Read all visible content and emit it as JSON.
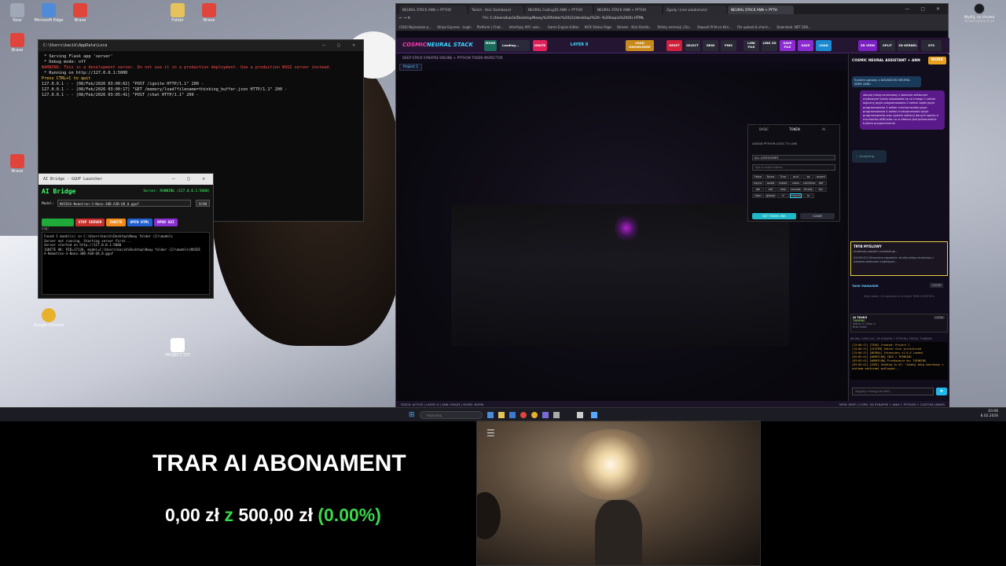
{
  "desktop": {
    "icons": [
      {
        "label": "Kosz",
        "color": "#a0a8b8"
      },
      {
        "label": "Microsoft Edge",
        "color": "#4f8bd8"
      },
      {
        "label": "Brave",
        "color": "#e0443a"
      },
      {
        "label": "Folder",
        "color": "#e6c25a"
      },
      {
        "label": "Brave",
        "color": "#e0443a"
      },
      {
        "label": "Brave",
        "color": "#e0443a"
      },
      {
        "label": "Brave",
        "color": "#e0443a"
      },
      {
        "label": "Google Chrome",
        "color": "#e8b12c"
      },
      {
        "label": "PROJECT.TXT",
        "color": "#ffffff"
      }
    ]
  },
  "cmd_window": {
    "title": "C:\\Users\\kacik\\AppData\\Loca",
    "lines": [
      " * Serving Flask app 'server'",
      " * Debug mode: off",
      "WARNING: This is a development server. Do not use it in a production deployment. Use a production WSGI server instead.",
      " * Running on http://127.0.0.1:5000",
      "Press CTRL+C to quit",
      "127.0.0.1 - - [08/Feb/2026 03:00:02] \"POST /ignite HTTP/1.1\" 200 -",
      "127.0.0.1 - - [08/Feb/2026 03:00:17] \"GET /memory/load?filename=thinking_buffer.json HTTP/1.1\" 200 -",
      "127.0.0.1 - - [08/Feb/2026 03:05:41] \"POST /chat HTTP/1.1\" 200 -"
    ]
  },
  "ai_bridge": {
    "window_title": "AI Bridge - GGUF Launcher",
    "title": "AI Bridge",
    "server_status": "Server: RUNNING (127.0.0.1:5000)",
    "model_label": "Model:",
    "model_value": "NVIDIA-Nemotron-3-Nano-30B-A3B-Q8_0.gguf",
    "scan_label": "SCAN",
    "buttons": {
      "start": "START SERVER",
      "stop": "STOP SERVER",
      "ignite": "IGNITE",
      "open_html": "OPEN HTML",
      "open_gui": "OPEN GUI"
    },
    "log_label": "Log:",
    "log_lines": [
      "Found 1 model(s) in C:\\Users\\kacik\\Desktop\\Nowy folder (2)\\models",
      "Server not running. Starting server first...",
      "Server started on http://127.0.0.1:5000",
      "IGNITE OK: PID=17136, model=C:\\Users\\kacik\\Desktop\\Nowy folder (2)\\models\\NVIDI",
      "A-Nemotron-3-Nano-30B-A3B-Q8_0.gguf"
    ]
  },
  "browser": {
    "tabs": [
      "NEURAL STACK ANN + PYTHO",
      "Twitch - Kick Dashboard",
      "NEURAL Coding3D ANN + PYTHO",
      "NEURAL STACK ANN + PYTHO",
      "Zgody i inne wiadomości",
      "NEURAL STACK ANN + PYTH"
    ],
    "address": "C:/Users/kacik/Desktop/Nowy%20folder%20(2)/desktop/%20--%20kopia%20(6).HTML",
    "address_prefix": "Plik",
    "bookmarks": [
      "(184) Najnowsze p...",
      "Stripe Express - Login",
      "Platform | Chat...",
      "Interfejsy API i usłu...",
      "Game Engine Editor",
      "KICK Status Page",
      "Stream - Kick Dashb...",
      "Efekty animacji | Do...",
      "Deposit Pl-N on Kim...",
      "File upload & sharin...",
      "Download .NET SDK..."
    ]
  },
  "app": {
    "logo_a": "COSMIC",
    "logo_b": "NEURAL STACK",
    "toolbar": {
      "mode": "MODE",
      "loading": "Loading...",
      "ignite": "IGNITE",
      "layer": "LAYER 8",
      "load_knowledge": "LOAD KNOWLEDGE",
      "reset": "RESET",
      "select": "SELECT",
      "grid": "GRID",
      "pins": "PINS",
      "link_file": "LINK FILE",
      "link_2d": "LINK 2D",
      "save_file": "SAVE FILE",
      "save": "SAVE",
      "load": "LOAD",
      "view_3d": "3D VIEW",
      "split": "SPLIT",
      "kernel": "2D KERNEL",
      "sys": "SYS"
    },
    "subtitle": "DEEP STACK SYNAPSE ENGINE + PYTHON TOKEN INSPECTOR",
    "project_tab": "Project 1",
    "token_panel": {
      "tabs": [
        "BASIC",
        "TOKEN",
        "AI"
      ],
      "heading": "ASSIGN PYTHON LOGIC TO LINK",
      "category": "ALL CATEGORIES",
      "search_placeholder": "Type to search tokens...",
      "tokens": [
        "False",
        "None",
        "True",
        "and",
        "as",
        "assert",
        "async",
        "await",
        "break",
        "class",
        "continue",
        "def",
        "del",
        "elif",
        "else",
        "except",
        "finally",
        "for",
        "from",
        "global",
        "if",
        "import",
        "in"
      ],
      "set_button": "SET TOKEN LINK",
      "clear_button": "CLEAR"
    },
    "assistant": {
      "title": "COSMIC NEURAL ASSISTANT + ANN",
      "badge": "WORK",
      "system_msg": "System gotowy z ADVANCED NEURAL WIRE ANN!",
      "user_msg": "zbuduj mózg neuronowy z wieloma sektorami myślowymi każdy odpowiada za co innego 1 sektor logiczny język programowania 2 sektor logiki język programowania 3 sektor mechanizmów język programowania 4 sektor funkcjonalności język programowania oraz system selekcji danych sporty a mechanika ANN wiec co w efekcie jest jednocześnie trybem przypomnienia",
      "thinking_label": "Analyzing",
      "thinking_mode_title": "TRYB MYŚLOWY",
      "thinking_mode_text": "Analizuję projekt i przewiduję...",
      "thinking_log": "[03:05:41] Otrzymano zapytanie: zbuduj mózg neuronowy z wieloma sektorami myślowymi...",
      "task_manager": "TASK MANAGER",
      "task_clear": "CLEAR",
      "task_empty": "Brak zadań. AI zaplanuje je w trybie TASK LOGISTICS",
      "ai_tasks": "AI TASKS",
      "ai_tasks_clear": "CLEAR",
      "ai_status_lines": [
        "THINKING",
        "Status: 0 | Step: 0",
        "Brak zadań"
      ],
      "log_header": "NEURAL CORE LOG | 3D SYNAPSE + PYTHON | STATUS: THINKING",
      "log_lines": [
        "[13:00:17] [TASK] Created: Project 1",
        "[13:00:17] [SYSTEM] Editor Core initialized",
        "[13:00:17] [NEURAL] Extensions v1.0.0 loaded",
        "[03:05:41] [WORKFLOW] IDLE > THINKING",
        "[03:05:41] [WORKFLOW] Przekazanie do: THINKING",
        "[03:05:41] [CHAT] Sending to AI: \"zbuduj mózg neuronowy z wieloma sektorami myślowymi..."
      ],
      "input_placeholder": "Zapytaj o kreację lub ANN..."
    },
    "status_left": "STACK: ACTIVE | LAYER: 8 | ANN: READY | MODE: NORM",
    "status_right": "MEM: DEEP | CORE: 3D SYNAPSE + ANN + PYTHON + CUSTOM LINKER"
  },
  "taskbar": {
    "search_placeholder": "Wyszukaj",
    "time": "03:06",
    "date": "8.02.2026"
  },
  "overlay": {
    "line1": "TRAR AI ABONAMENT",
    "amount_current": "0,00 zł",
    "amount_of": "z",
    "amount_goal": "500,00 zł",
    "percent": "(0.00%)",
    "progress": 0
  },
  "user_widget": {
    "name": "Wyślij, co chcesz",
    "sub": "stream@kacik.pl"
  }
}
